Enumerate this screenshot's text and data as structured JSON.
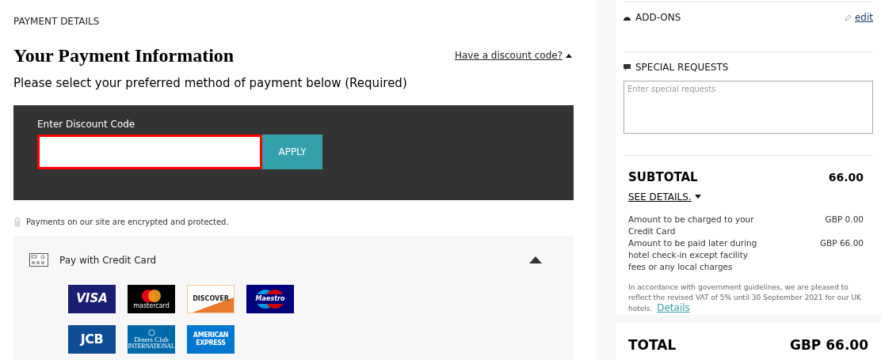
{
  "section_label": "PAYMENT DETAILS",
  "title": "Your Payment Information",
  "discount_toggle": {
    "label": "Have a discount code?",
    "expanded": true
  },
  "subtitle": "Please select your preferred method of payment below (Required)",
  "discount": {
    "label": "Enter Discount Code",
    "error": true,
    "button": "APPLY"
  },
  "security_note": "Payments on our site are encrypted and protected.",
  "payment_method": {
    "label": "Pay with Credit Card",
    "expanded": true,
    "cards": [
      {
        "kind": "visa",
        "lines": [
          "VISA"
        ]
      },
      {
        "kind": "mastercard",
        "lines": [
          "mastercard"
        ]
      },
      {
        "kind": "discover",
        "lines": [
          "DISCOVER"
        ]
      },
      {
        "kind": "maestro",
        "lines": [
          "Maestro"
        ]
      },
      {
        "kind": "jcb",
        "lines": [
          "JCB"
        ]
      },
      {
        "kind": "diners",
        "lines": [
          "Diners Club",
          "INTERNATIONAL"
        ]
      },
      {
        "kind": "amex",
        "lines": [
          "AMERICAN",
          "EXPRESS"
        ]
      }
    ]
  },
  "addons": {
    "title": "ADD-ONS",
    "edit": "edit"
  },
  "special_requests": {
    "title": "SPECIAL REQUESTS",
    "placeholder": "Enter special requests"
  },
  "subtotal": {
    "label": "SUBTOTAL",
    "amount": "66.00",
    "details_toggle": {
      "label": "SEE DETAILS.",
      "expanded": true
    },
    "lines": [
      {
        "label": "Amount to be charged to your Credit Card",
        "amount": "GBP 0.00"
      },
      {
        "label": "Amount to be paid later during hotel check-in except facility fees or any local charges",
        "amount": "GBP 66.00"
      }
    ],
    "vat_note": "In accordance with government guidelines, we are pleased to reflect the revised VAT of 5% until 30 September 2021 for our UK hotels.",
    "vat_link": "Details"
  },
  "total": {
    "label": "TOTAL",
    "amount": "GBP 66.00"
  }
}
